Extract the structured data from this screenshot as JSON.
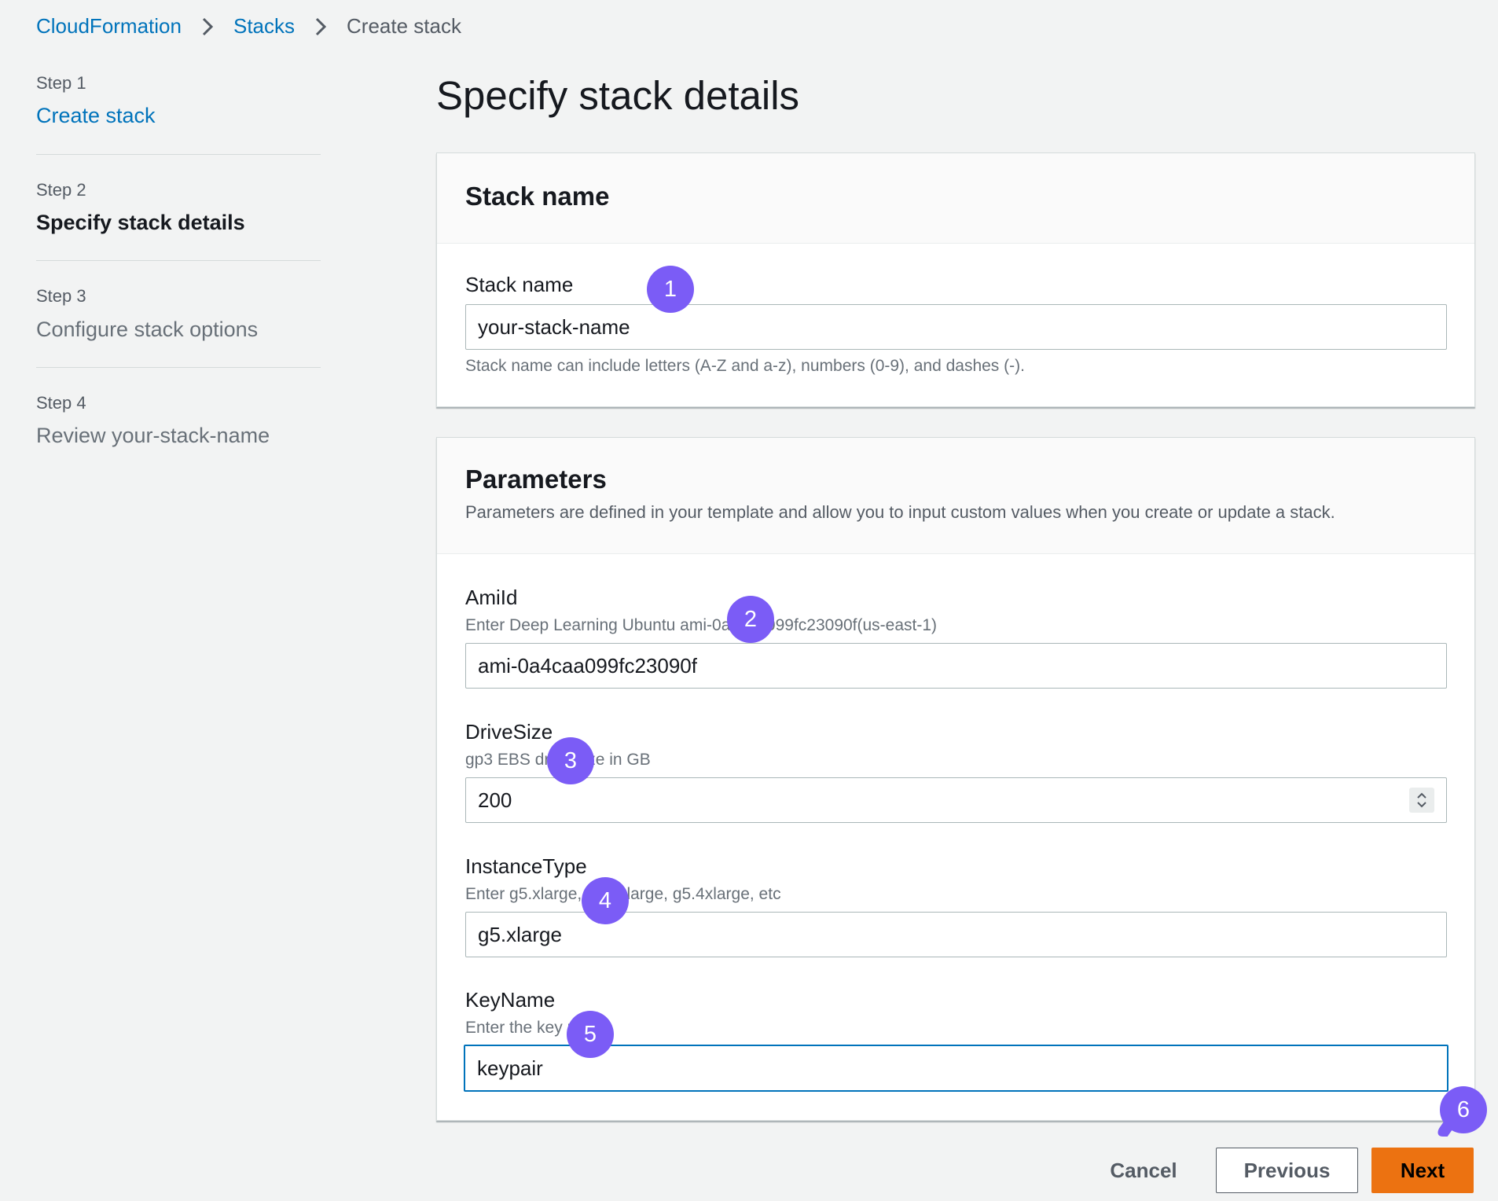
{
  "breadcrumb": [
    "CloudFormation",
    "Stacks",
    "Create stack"
  ],
  "steps": [
    {
      "num": "Step 1",
      "label": "Create stack"
    },
    {
      "num": "Step 2",
      "label": "Specify stack details"
    },
    {
      "num": "Step 3",
      "label": "Configure stack options"
    },
    {
      "num": "Step 4",
      "label": "Review your-stack-name"
    }
  ],
  "page_title": "Specify stack details",
  "stack_panel": {
    "title": "Stack name",
    "field_label": "Stack name",
    "value": "your-stack-name",
    "hint": "Stack name can include letters (A-Z and a-z), numbers (0-9), and dashes (-)."
  },
  "params_panel": {
    "title": "Parameters",
    "description": "Parameters are defined in your template and allow you to input custom values when you create or update a stack.",
    "fields": [
      {
        "label": "AmiId",
        "desc": "Enter Deep Learning Ubuntu ami-0a4caa099fc23090f(us-east-1)",
        "value": "ami-0a4caa099fc23090f"
      },
      {
        "label": "DriveSize",
        "desc": "gp3 EBS drive size in GB",
        "value": "200"
      },
      {
        "label": "InstanceType",
        "desc": "Enter g5.xlarge, g5.2xlarge, g5.4xlarge, etc",
        "value": "g5.xlarge"
      },
      {
        "label": "KeyName",
        "desc": "Enter the key name",
        "value": "keypair"
      }
    ]
  },
  "badges": [
    "1",
    "2",
    "3",
    "4",
    "5",
    "6"
  ],
  "buttons": {
    "cancel": "Cancel",
    "previous": "Previous",
    "next": "Next"
  },
  "colors": {
    "link": "#0073bb",
    "accent": "#ec7211",
    "badge": "#7b5cf6"
  }
}
